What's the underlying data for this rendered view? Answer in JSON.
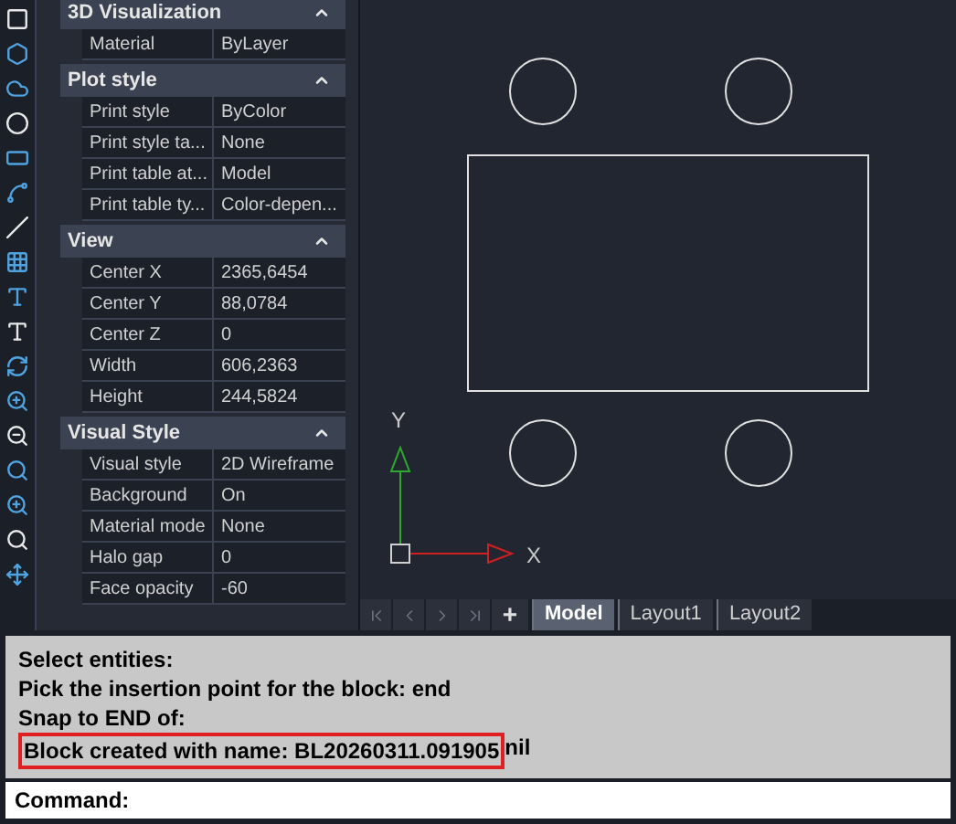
{
  "properties": {
    "sections": [
      {
        "title": "3D Visualization",
        "expanded": true,
        "rows": [
          {
            "label": "Material",
            "value": "ByLayer"
          }
        ]
      },
      {
        "title": "Plot style",
        "expanded": true,
        "rows": [
          {
            "label": "Print style",
            "value": "ByColor"
          },
          {
            "label": "Print style ta...",
            "value": "None"
          },
          {
            "label": "Print table at...",
            "value": "Model"
          },
          {
            "label": "Print table ty...",
            "value": "Color-depen..."
          }
        ]
      },
      {
        "title": "View",
        "expanded": true,
        "rows": [
          {
            "label": "Center X",
            "value": "2365,6454"
          },
          {
            "label": "Center Y",
            "value": "88,0784"
          },
          {
            "label": "Center Z",
            "value": "0"
          },
          {
            "label": "Width",
            "value": "606,2363"
          },
          {
            "label": "Height",
            "value": "244,5824"
          }
        ]
      },
      {
        "title": "Visual Style",
        "expanded": true,
        "rows": [
          {
            "label": "Visual style",
            "value": "2D Wireframe"
          },
          {
            "label": "Background",
            "value": "On"
          },
          {
            "label": "Material mode",
            "value": "None"
          },
          {
            "label": "Halo gap",
            "value": "0"
          },
          {
            "label": "Face opacity",
            "value": "-60"
          }
        ]
      }
    ]
  },
  "ucs": {
    "x_label": "X",
    "y_label": "Y"
  },
  "layout_tabs": {
    "add": "+",
    "tabs": [
      {
        "label": "Model",
        "selected": true
      },
      {
        "label": "Layout1",
        "selected": false
      },
      {
        "label": "Layout2",
        "selected": false
      }
    ]
  },
  "command_history": [
    {
      "text": "Select entities:",
      "highlighted": false
    },
    {
      "text": "Pick the insertion point for the block: end",
      "highlighted": false
    },
    {
      "text": "Snap to END of:",
      "highlighted": false
    },
    {
      "text": "Block created with name: BL20260311.091905",
      "highlighted": true,
      "tail": "nil"
    }
  ],
  "command_line": {
    "prompt": "Command:"
  }
}
